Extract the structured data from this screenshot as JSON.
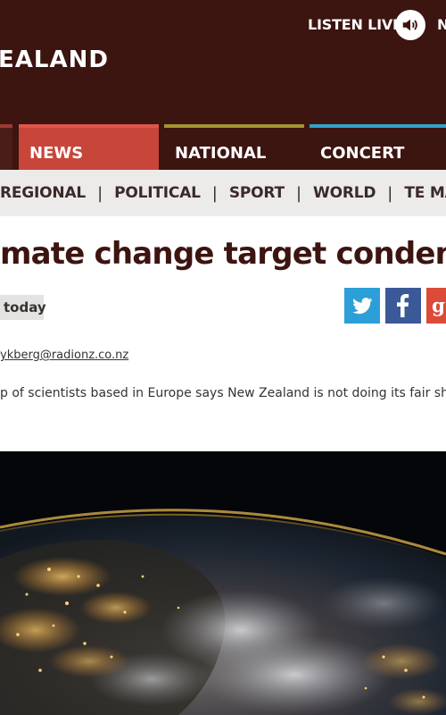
{
  "header": {
    "logo_text": "EALAND",
    "listen_live": "LISTEN LIVE",
    "nav_partial": "N"
  },
  "tabs": [
    {
      "label": ""
    },
    {
      "label": "NEWS"
    },
    {
      "label": "NATIONAL"
    },
    {
      "label": "CONCERT"
    }
  ],
  "subnav": {
    "items": [
      "REGIONAL",
      "POLITICAL",
      "SPORT",
      "WORLD",
      "TE MANU K"
    ],
    "separator": "|"
  },
  "article": {
    "headline": "mate change target condemned",
    "date": "today",
    "email": "ykberg@radionz.co.nz",
    "lede": "p of scientists based in Europe says New Zealand is not doing its fair sh"
  },
  "share": {
    "twitter_icon": "twitter-icon",
    "facebook_icon": "facebook-icon",
    "google_icon": "google-plus-icon"
  },
  "colors": {
    "header_bg": "#3c1410",
    "news_tab": "#c8453a",
    "national_accent": "#a29430",
    "concert_accent": "#2ea3c9",
    "subnav_bg": "#ecebea"
  }
}
